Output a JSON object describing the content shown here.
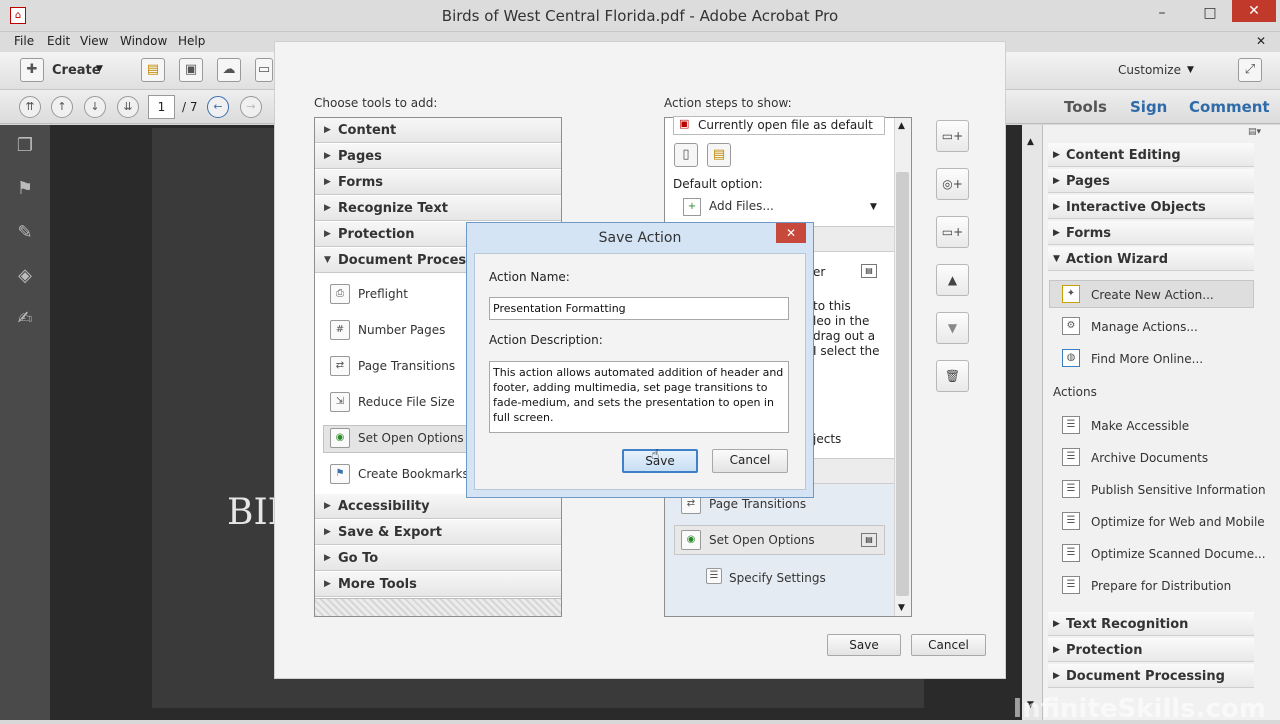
{
  "window": {
    "title": "Birds of West Central Florida.pdf - Adobe Acrobat Pro",
    "minimize": "–",
    "maximize": "□",
    "close": "✕"
  },
  "menu": {
    "file": "File",
    "edit": "Edit",
    "view": "View",
    "window": "Window",
    "help": "Help",
    "close": "✕"
  },
  "toolbar": {
    "create_label": "Create",
    "customize_label": "Customize"
  },
  "pagenav": {
    "current_page": "1",
    "total": "/ 7"
  },
  "tasks": {
    "tools": "Tools",
    "sign": "Sign",
    "comment": "Comment"
  },
  "page_preview_text": "BIR",
  "edit_action": {
    "choose_tools_label": "Choose tools to add:",
    "action_steps_label": "Action steps to show:",
    "categories_top": [
      "Content",
      "Pages",
      "Forms",
      "Recognize Text",
      "Protection",
      "Document Processing"
    ],
    "document_processing_items": [
      "Preflight",
      "Number Pages",
      "Page Transitions",
      "Reduce File Size",
      "Set Open Options",
      "Create Bookmarks fr"
    ],
    "categories_bottom": [
      "Accessibility",
      "Save & Export",
      "Go To",
      "More Tools"
    ],
    "steps": {
      "file_option": "Currently open file as default",
      "default_option_label": "Default option:",
      "add_files": "Add Files...",
      "partial_1": "er",
      "partial_2": "to this",
      "partial_3": "leo in the",
      "partial_4": "drag out a",
      "partial_5": "I select the",
      "partial_6": "jects",
      "page_transitions": "Page Transitions",
      "set_open_options": "Set Open Options",
      "specify_settings": "Specify Settings"
    },
    "save_button": "Save",
    "cancel_button": "Cancel"
  },
  "save_action_dialog": {
    "title": "Save Action",
    "name_label": "Action Name:",
    "name_value": "Presentation Formatting",
    "description_label": "Action Description:",
    "description_value": "This action allows automated addition of header and footer, adding multimedia, set page transitions to fade-medium, and sets the presentation to open in full screen.",
    "save_button": "Save",
    "cancel_button": "Cancel"
  },
  "right_panel": {
    "sections_top": [
      "Content Editing",
      "Pages",
      "Interactive Objects",
      "Forms",
      "Action Wizard"
    ],
    "wizard_items": [
      "Create New Action...",
      "Manage Actions...",
      "Find More Online..."
    ],
    "actions_heading": "Actions",
    "actions": [
      "Make Accessible",
      "Archive Documents",
      "Publish Sensitive Information",
      "Optimize for Web and Mobile",
      "Optimize Scanned Docume...",
      "Prepare for Distribution"
    ],
    "sections_bottom": [
      "Text Recognition",
      "Protection",
      "Document Processing"
    ]
  },
  "watermark": "InfiniteSkills.com"
}
